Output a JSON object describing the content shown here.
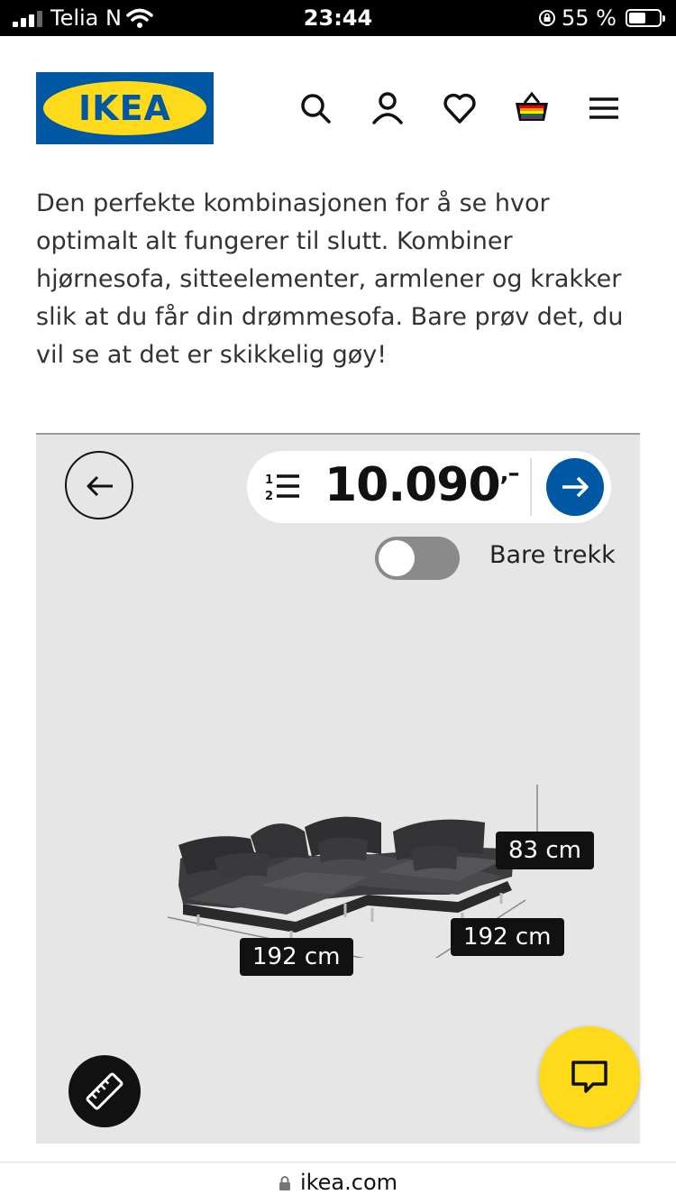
{
  "status_bar": {
    "carrier": "Telia N",
    "time": "23:44",
    "battery_percent": "55 %"
  },
  "header": {
    "logo_text": "IKEA",
    "icons": [
      "search-icon",
      "user-icon",
      "heart-icon",
      "cart-icon",
      "menu-icon"
    ]
  },
  "description": "Den perfekte kombinasjonen for å se hvor optimalt alt fungerer til slutt. Kombiner hjørnesofa, sitteelementer, armlener og krakker slik at du får din drømmesofa. Bare prøv det, du vil se at det er skikkelig gøy!",
  "configurator": {
    "price": "10.090",
    "price_suffix": ",–",
    "toggle_label": "Bare trekk",
    "toggle_on": false,
    "dimensions": {
      "height": "83 cm",
      "depth": "192 cm",
      "width": "192 cm"
    }
  },
  "url_bar": {
    "url": "ikea.com"
  },
  "colors": {
    "ikea_blue": "#0058a3",
    "ikea_yellow": "#ffda1a"
  }
}
